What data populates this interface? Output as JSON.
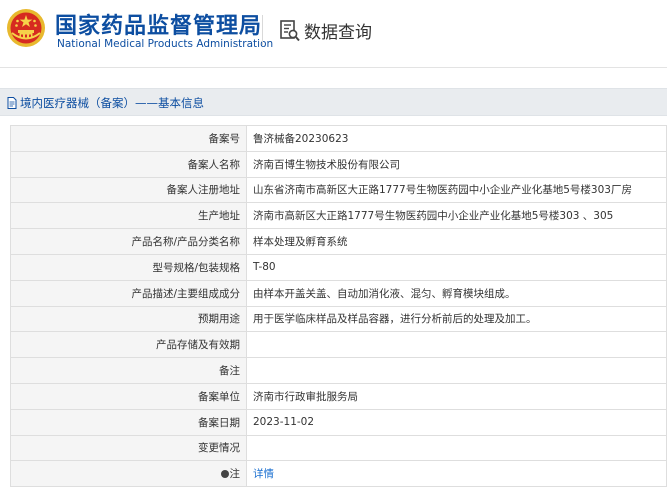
{
  "header": {
    "brand_cn": "国家药品监督管理局",
    "brand_en": "National Medical Products Administration",
    "query_label": "数据查询",
    "emblem_icon": "national-emblem-icon",
    "query_icon": "document-search-icon",
    "brand_color": "#0d4ea1"
  },
  "breadcrumb": {
    "text": "境内医疗器械（备案）——基本信息",
    "icon": "document-icon"
  },
  "rows": [
    {
      "label": "备案号",
      "value": "鲁济械备20230623"
    },
    {
      "label": "备案人名称",
      "value": "济南百博生物技术股份有限公司"
    },
    {
      "label": "备案人注册地址",
      "value": "山东省济南市高新区大正路1777号生物医药园中小企业产业化基地5号楼303厂房"
    },
    {
      "label": "生产地址",
      "value": "济南市高新区大正路1777号生物医药园中小企业产业化基地5号楼303 、305"
    },
    {
      "label": "产品名称/产品分类名称",
      "value": "样本处理及孵育系统"
    },
    {
      "label": "型号规格/包装规格",
      "value": "T-80"
    },
    {
      "label": "产品描述/主要组成成分",
      "value": "由样本开盖关盖、自动加消化液、混匀、孵育模块组成。"
    },
    {
      "label": "预期用途",
      "value": "用于医学临床样品及样品容器，进行分析前后的处理及加工。"
    },
    {
      "label": "产品存储及有效期",
      "value": ""
    },
    {
      "label": "备注",
      "value": ""
    },
    {
      "label": "备案单位",
      "value": "济南市行政审批服务局"
    },
    {
      "label": "备案日期",
      "value": "2023-11-02"
    },
    {
      "label": "变更情况",
      "value": ""
    }
  ],
  "note_row": {
    "label": "注",
    "link_text": "详情",
    "icon": "note-icon",
    "link_color": "#1a6fd0"
  }
}
